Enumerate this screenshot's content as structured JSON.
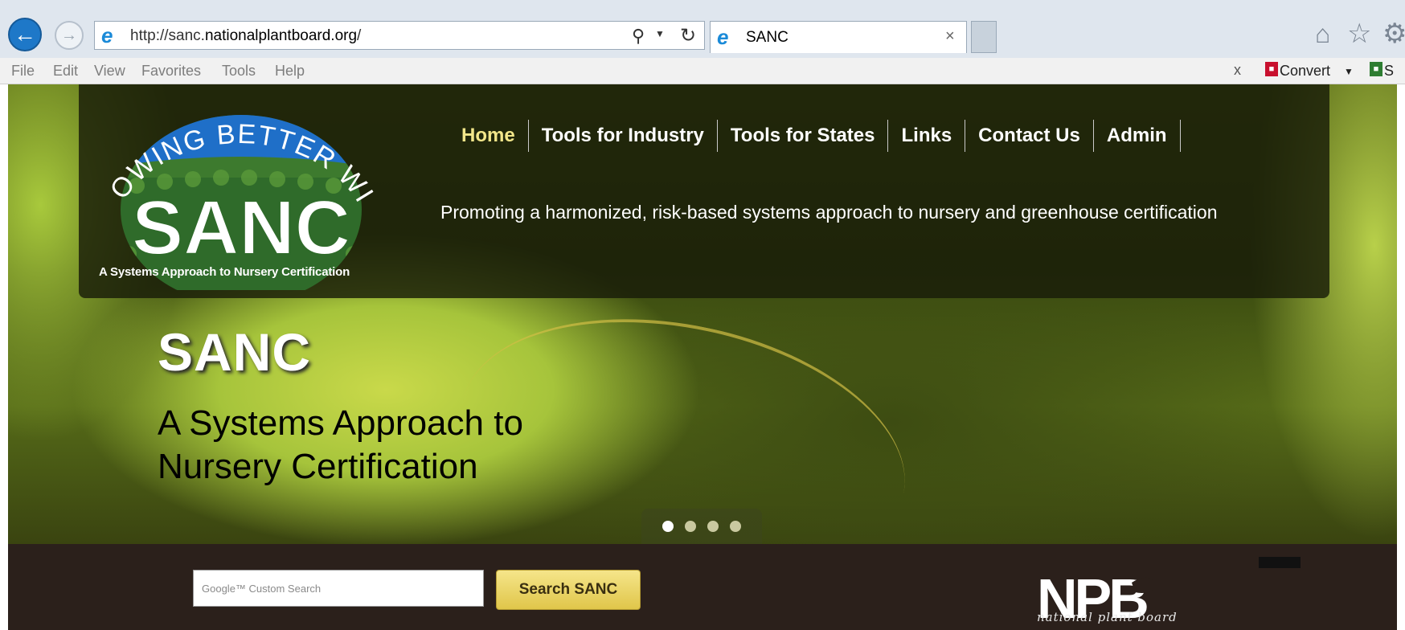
{
  "browser": {
    "url_prefix": "http://sanc.",
    "url_domain": "nationalplantboard.org",
    "url_suffix": "/",
    "tab_title": "SANC",
    "menu": [
      "File",
      "Edit",
      "View",
      "Favorites",
      "Tools",
      "Help"
    ],
    "toolbar": {
      "close_label": "x",
      "convert_label": "Convert",
      "select_label": "S"
    }
  },
  "site": {
    "logo": {
      "arc_text": "GROWING BETTER WITH",
      "wordmark": "SANC",
      "caption": "A Systems Approach to Nursery Certification"
    },
    "nav": [
      "Home",
      "Tools for Industry",
      "Tools for States",
      "Links",
      "Contact Us",
      "Admin"
    ],
    "tagline": "Promoting a harmonized, risk-based systems approach to nursery and greenhouse certification",
    "hero": {
      "title": "SANC",
      "subtitle_line1": "A Systems Approach to",
      "subtitle_line2": "Nursery Certification"
    },
    "slider": {
      "slides": 4,
      "active": 1
    },
    "search": {
      "placeholder": "Google™ Custom Search",
      "button_label": "Search SANC"
    },
    "npb": {
      "mark": "NPB",
      "caption": "national plant board"
    }
  },
  "colors": {
    "chrome_bg": "#dfe6ee",
    "back_button": "#1e78c8",
    "nav_active": "#f2e68a",
    "footer_bg": "#2b201b",
    "search_button": "#e0c64a"
  }
}
